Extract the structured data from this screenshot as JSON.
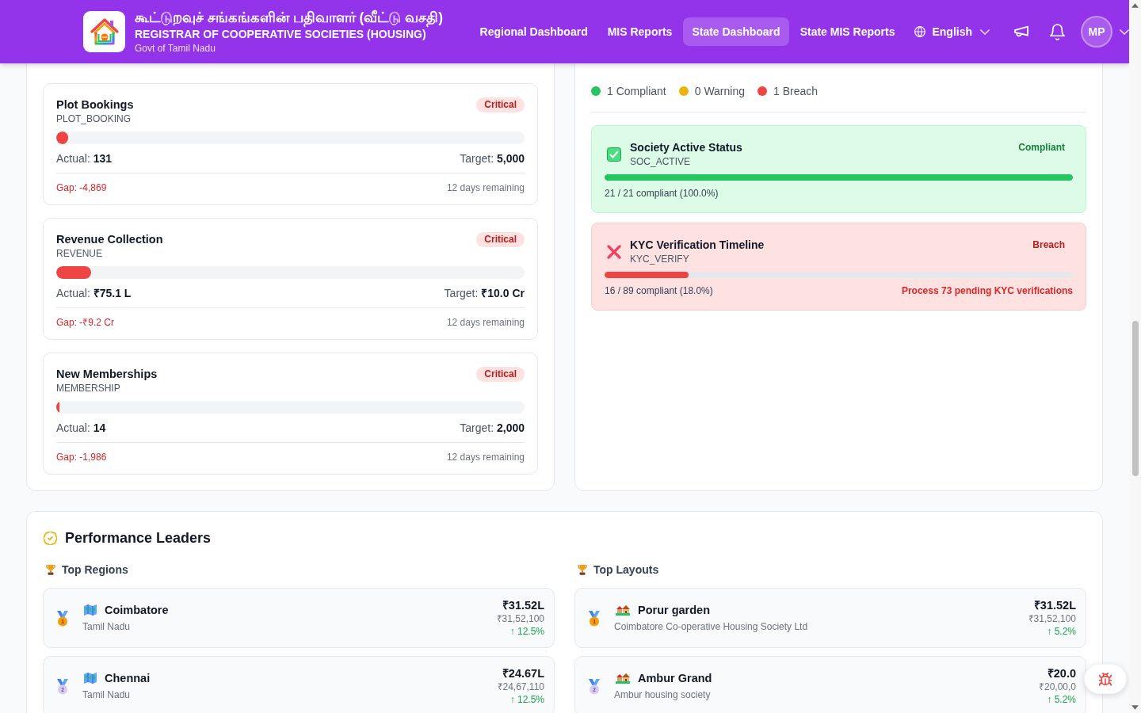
{
  "header": {
    "title": "கூட்டுறவுச் சங்கங்களின் பதிவாளர் (வீட்டு வசதி)",
    "subtitle": "REGISTRAR OF COOPERATIVE SOCIETIES (HOUSING)",
    "tagline": "Govt of Tamil Nadu",
    "nav": [
      {
        "label": "Regional Dashboard",
        "selected": false
      },
      {
        "label": "MIS Reports",
        "selected": false
      },
      {
        "label": "State Dashboard",
        "selected": true
      },
      {
        "label": "State MIS Reports",
        "selected": false
      }
    ],
    "language": "English",
    "avatar": "MP"
  },
  "kpi_trackers": [
    {
      "name": "Plot Bookings",
      "code": "PLOT_BOOKING",
      "status": "Critical",
      "level": 0.026,
      "actual": "Actual: **131**",
      "target": "Target: **5,000**",
      "gap": "Gap: -4,869",
      "remaining": "12 days remaining"
    },
    {
      "name": "Revenue Collection",
      "code": "REVENUE",
      "status": "Critical",
      "level": 0.0751,
      "actual": "Actual: **₹75.1 L**",
      "target": "Target: **₹10.0 Cr**",
      "gap": "Gap: -₹9.2 Cr",
      "remaining": "12 days remaining"
    },
    {
      "name": "New Memberships",
      "code": "MEMBERSHIP",
      "status": "Critical",
      "level": 0.007,
      "actual": "Actual: **14**",
      "target": "Target: **2,000**",
      "gap": "Gap: -1,986",
      "remaining": "12 days remaining"
    }
  ],
  "policy_compliance": {
    "legend": [
      {
        "label": "1 Compliant",
        "color": "#22c55e"
      },
      {
        "label": "0 Warning",
        "color": "#eab308"
      },
      {
        "label": "1 Breach",
        "color": "#ef4444"
      }
    ],
    "policies": [
      {
        "kind": "compliant",
        "name": "Society Active Status",
        "code": "SOC_ACTIVE",
        "status": "Compliant",
        "level": 1.0,
        "summary": "21 / 21 compliant (100.0%)"
      },
      {
        "kind": "breach",
        "name": "KYC Verification Timeline",
        "code": "KYC_VERIFY",
        "status": "Breach",
        "level": 0.18,
        "summary": "16 / 89 compliant (18.0%)",
        "action": "Process 73 pending KYC verifications"
      }
    ]
  },
  "performance_leaders": {
    "title": "Performance Leaders",
    "columns": [
      {
        "kind": "region",
        "title": "Top Regions",
        "rows": [
          {
            "kind": "gold",
            "rank": "1",
            "name": "Coimbatore",
            "subtitle": "Tamil Nadu",
            "amount": "₹31.52L",
            "exact": "₹31,52,100",
            "change": "↑ 12.5%"
          },
          {
            "kind": "silver",
            "rank": "2",
            "name": "Chennai",
            "subtitle": "Tamil Nadu",
            "amount": "₹24.67L",
            "exact": "₹24,67,110",
            "change": "↑ 12.5%"
          }
        ]
      },
      {
        "kind": "layout",
        "title": "Top Layouts",
        "rows": [
          {
            "kind": "gold",
            "rank": "1",
            "name": "Porur garden",
            "subtitle": "Coimbatore Co-operative Housing Society Ltd",
            "amount": "₹31.52L",
            "exact": "₹31,52,100",
            "change": "↑ 5.2%"
          },
          {
            "kind": "silver",
            "rank": "2",
            "name": "Ambur Grand",
            "subtitle": "Ambur housing society",
            "amount": "₹20.0",
            "exact": "₹20,00,0",
            "change": "↑ 5.2%"
          }
        ]
      }
    ]
  }
}
